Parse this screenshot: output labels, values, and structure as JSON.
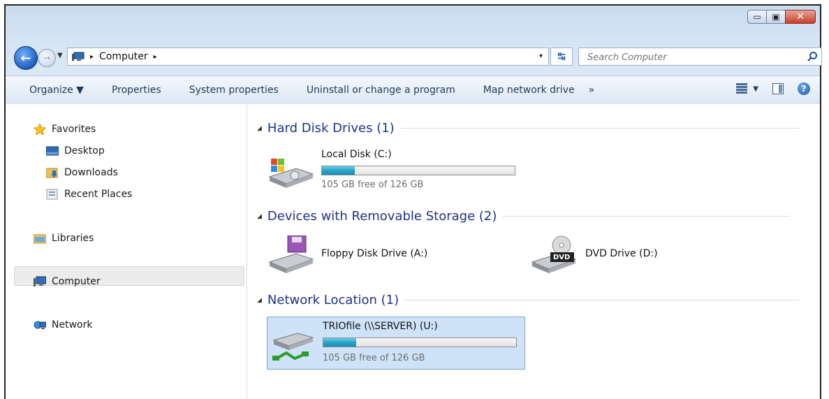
{
  "window": {
    "minimize_glyph": "▭",
    "maximize_glyph": "▣",
    "close_glyph": "✕"
  },
  "address": {
    "crumbs": [
      "Computer"
    ],
    "separator": "▸",
    "dropdown": "▾"
  },
  "search": {
    "placeholder": "Search Computer"
  },
  "toolbar": {
    "organize": "Organize ▼",
    "properties": "Properties",
    "system_properties": "System properties",
    "uninstall": "Uninstall or change a program",
    "map_network_drive": "Map network drive",
    "more": "»",
    "help": "?",
    "views_dropdown": "▼"
  },
  "sidebar": {
    "favorites": "Favorites",
    "desktop": "Desktop",
    "downloads": "Downloads",
    "recent_places": "Recent Places",
    "libraries": "Libraries",
    "computer": "Computer",
    "network": "Network"
  },
  "groups": {
    "hard_disk": "Hard Disk Drives (1)",
    "removable": "Devices with Removable Storage (2)",
    "network": "Network Location (1)"
  },
  "drives": {
    "local_disk": {
      "name": "Local Disk (C:)",
      "free": "105 GB free of 126 GB",
      "used_fraction": 0.17
    },
    "floppy": {
      "name": "Floppy Disk Drive (A:)"
    },
    "dvd": {
      "name": "DVD Drive (D:)",
      "badge": "DVD"
    },
    "network_drive": {
      "name": "TRIOfile (\\\\SERVER) (U:)",
      "free": "105 GB free of 126 GB",
      "used_fraction": 0.17
    }
  },
  "colors": {
    "accent": "#1e3287",
    "bar_fill": "#27a3c8",
    "selection": "#cfe3f8"
  }
}
